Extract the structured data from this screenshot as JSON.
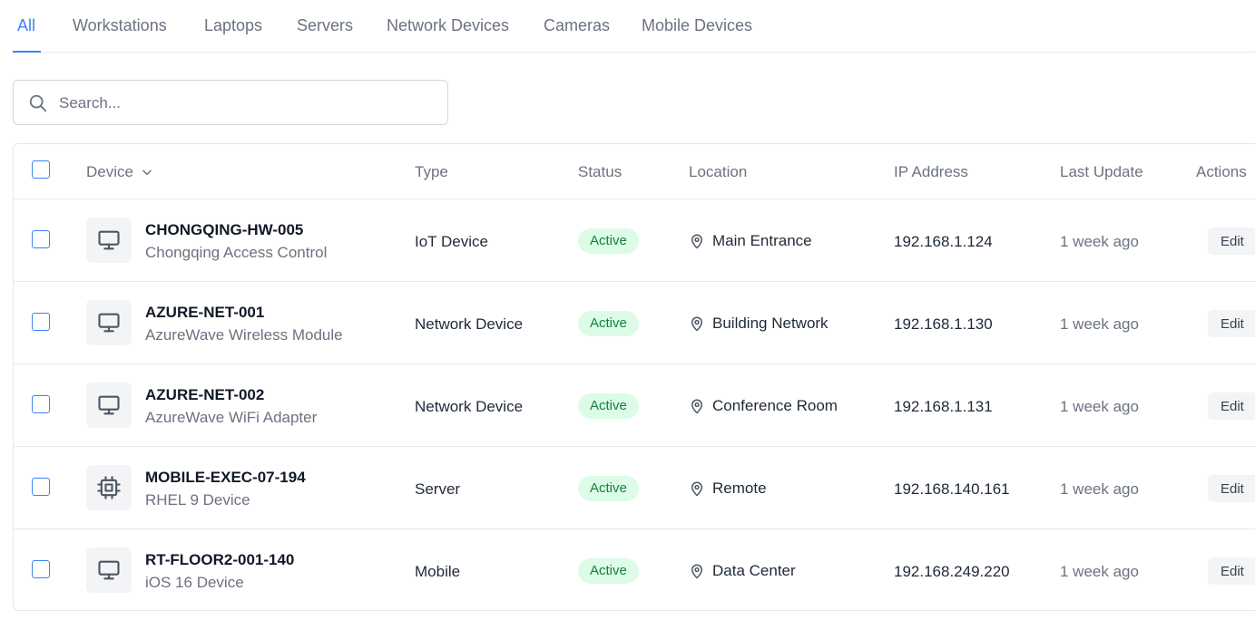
{
  "tabs": [
    {
      "label": "All",
      "active": true
    },
    {
      "label": "Workstations",
      "active": false
    },
    {
      "label": "Laptops",
      "active": false
    },
    {
      "label": "Servers",
      "active": false
    },
    {
      "label": "Network Devices",
      "active": false
    },
    {
      "label": "Cameras",
      "active": false
    },
    {
      "label": "Mobile Devices",
      "active": false
    }
  ],
  "search": {
    "placeholder": "Search...",
    "icon": "search-icon"
  },
  "table": {
    "columns": [
      "Device",
      "Type",
      "Status",
      "Location",
      "IP Address",
      "Last Update",
      "Actions"
    ],
    "sort_icon": "chevron-down-icon",
    "rows": [
      {
        "name": "CHONGQING-HW-005",
        "subtitle": "Chongqing Access Control",
        "icon": "monitor-icon",
        "type": "IoT Device",
        "status": "Active",
        "location": "Main Entrance",
        "ip": "192.168.1.124",
        "last_update": "1 week ago",
        "action": "Edit"
      },
      {
        "name": "AZURE-NET-001",
        "subtitle": "AzureWave Wireless Module",
        "icon": "monitor-icon",
        "type": "Network Device",
        "status": "Active",
        "location": "Building Network",
        "ip": "192.168.1.130",
        "last_update": "1 week ago",
        "action": "Edit"
      },
      {
        "name": "AZURE-NET-002",
        "subtitle": "AzureWave WiFi Adapter",
        "icon": "monitor-icon",
        "type": "Network Device",
        "status": "Active",
        "location": "Conference Room",
        "ip": "192.168.1.131",
        "last_update": "1 week ago",
        "action": "Edit"
      },
      {
        "name": "MOBILE-EXEC-07-194",
        "subtitle": "RHEL 9 Device",
        "icon": "cpu-icon",
        "type": "Server",
        "status": "Active",
        "location": "Remote",
        "ip": "192.168.140.161",
        "last_update": "1 week ago",
        "action": "Edit"
      },
      {
        "name": "RT-FLOOR2-001-140",
        "subtitle": "iOS 16 Device",
        "icon": "monitor-icon",
        "type": "Mobile",
        "status": "Active",
        "location": "Data Center",
        "ip": "192.168.249.220",
        "last_update": "1 week ago",
        "action": "Edit"
      }
    ]
  },
  "colors": {
    "accent": "#3b82f6",
    "status_active_bg": "#dcfce7",
    "status_active_text": "#15803d"
  }
}
